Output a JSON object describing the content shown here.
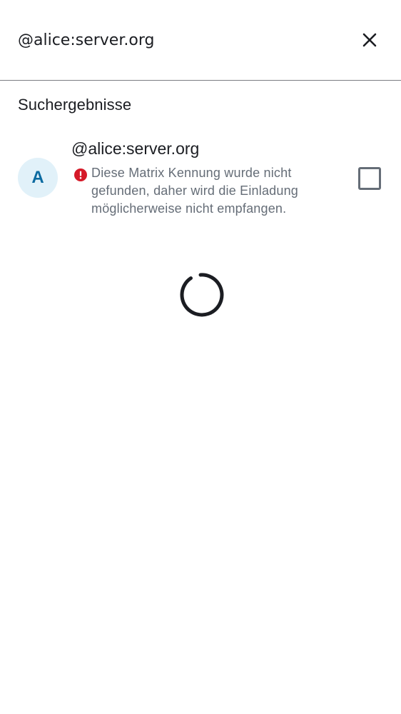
{
  "search": {
    "query": "@alice:server.org",
    "placeholder": ""
  },
  "icons": {
    "close": "close-icon",
    "error": "error-icon",
    "loading": "loading-spinner"
  },
  "results": {
    "section_title": "Suchergebnisse",
    "items": [
      {
        "avatar_initial": "A",
        "user_id": "@alice:server.org",
        "warning": "Diese Matrix Kennung wurde nicht gefunden, daher wird die Einladung möglicherweise nicht empfangen.",
        "selected": false
      }
    ]
  },
  "colors": {
    "text_primary": "#1b1d22",
    "text_secondary": "#656d77",
    "avatar_bg": "#e1f1f9",
    "avatar_fg": "#0b6aa0",
    "error": "#d51928",
    "divider": "#7b7d82"
  }
}
